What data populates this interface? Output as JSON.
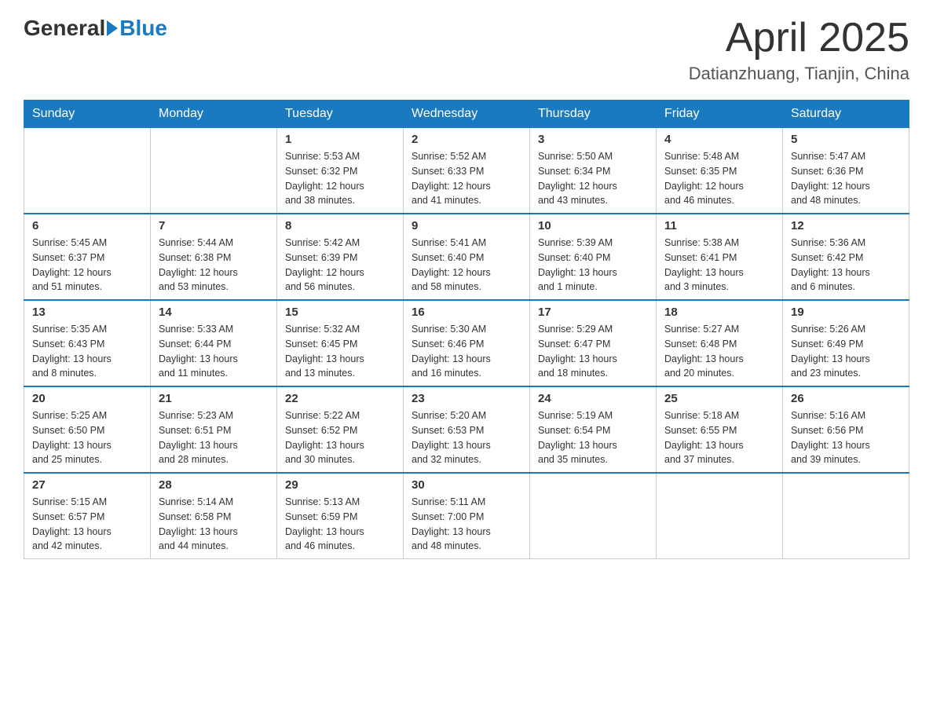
{
  "header": {
    "logo_general": "General",
    "logo_blue": "Blue",
    "month_title": "April 2025",
    "location": "Datianzhuang, Tianjin, China"
  },
  "days_of_week": [
    "Sunday",
    "Monday",
    "Tuesday",
    "Wednesday",
    "Thursday",
    "Friday",
    "Saturday"
  ],
  "weeks": [
    {
      "days": [
        {
          "date": "",
          "info": ""
        },
        {
          "date": "",
          "info": ""
        },
        {
          "date": "1",
          "info": "Sunrise: 5:53 AM\nSunset: 6:32 PM\nDaylight: 12 hours\nand 38 minutes."
        },
        {
          "date": "2",
          "info": "Sunrise: 5:52 AM\nSunset: 6:33 PM\nDaylight: 12 hours\nand 41 minutes."
        },
        {
          "date": "3",
          "info": "Sunrise: 5:50 AM\nSunset: 6:34 PM\nDaylight: 12 hours\nand 43 minutes."
        },
        {
          "date": "4",
          "info": "Sunrise: 5:48 AM\nSunset: 6:35 PM\nDaylight: 12 hours\nand 46 minutes."
        },
        {
          "date": "5",
          "info": "Sunrise: 5:47 AM\nSunset: 6:36 PM\nDaylight: 12 hours\nand 48 minutes."
        }
      ]
    },
    {
      "days": [
        {
          "date": "6",
          "info": "Sunrise: 5:45 AM\nSunset: 6:37 PM\nDaylight: 12 hours\nand 51 minutes."
        },
        {
          "date": "7",
          "info": "Sunrise: 5:44 AM\nSunset: 6:38 PM\nDaylight: 12 hours\nand 53 minutes."
        },
        {
          "date": "8",
          "info": "Sunrise: 5:42 AM\nSunset: 6:39 PM\nDaylight: 12 hours\nand 56 minutes."
        },
        {
          "date": "9",
          "info": "Sunrise: 5:41 AM\nSunset: 6:40 PM\nDaylight: 12 hours\nand 58 minutes."
        },
        {
          "date": "10",
          "info": "Sunrise: 5:39 AM\nSunset: 6:40 PM\nDaylight: 13 hours\nand 1 minute."
        },
        {
          "date": "11",
          "info": "Sunrise: 5:38 AM\nSunset: 6:41 PM\nDaylight: 13 hours\nand 3 minutes."
        },
        {
          "date": "12",
          "info": "Sunrise: 5:36 AM\nSunset: 6:42 PM\nDaylight: 13 hours\nand 6 minutes."
        }
      ]
    },
    {
      "days": [
        {
          "date": "13",
          "info": "Sunrise: 5:35 AM\nSunset: 6:43 PM\nDaylight: 13 hours\nand 8 minutes."
        },
        {
          "date": "14",
          "info": "Sunrise: 5:33 AM\nSunset: 6:44 PM\nDaylight: 13 hours\nand 11 minutes."
        },
        {
          "date": "15",
          "info": "Sunrise: 5:32 AM\nSunset: 6:45 PM\nDaylight: 13 hours\nand 13 minutes."
        },
        {
          "date": "16",
          "info": "Sunrise: 5:30 AM\nSunset: 6:46 PM\nDaylight: 13 hours\nand 16 minutes."
        },
        {
          "date": "17",
          "info": "Sunrise: 5:29 AM\nSunset: 6:47 PM\nDaylight: 13 hours\nand 18 minutes."
        },
        {
          "date": "18",
          "info": "Sunrise: 5:27 AM\nSunset: 6:48 PM\nDaylight: 13 hours\nand 20 minutes."
        },
        {
          "date": "19",
          "info": "Sunrise: 5:26 AM\nSunset: 6:49 PM\nDaylight: 13 hours\nand 23 minutes."
        }
      ]
    },
    {
      "days": [
        {
          "date": "20",
          "info": "Sunrise: 5:25 AM\nSunset: 6:50 PM\nDaylight: 13 hours\nand 25 minutes."
        },
        {
          "date": "21",
          "info": "Sunrise: 5:23 AM\nSunset: 6:51 PM\nDaylight: 13 hours\nand 28 minutes."
        },
        {
          "date": "22",
          "info": "Sunrise: 5:22 AM\nSunset: 6:52 PM\nDaylight: 13 hours\nand 30 minutes."
        },
        {
          "date": "23",
          "info": "Sunrise: 5:20 AM\nSunset: 6:53 PM\nDaylight: 13 hours\nand 32 minutes."
        },
        {
          "date": "24",
          "info": "Sunrise: 5:19 AM\nSunset: 6:54 PM\nDaylight: 13 hours\nand 35 minutes."
        },
        {
          "date": "25",
          "info": "Sunrise: 5:18 AM\nSunset: 6:55 PM\nDaylight: 13 hours\nand 37 minutes."
        },
        {
          "date": "26",
          "info": "Sunrise: 5:16 AM\nSunset: 6:56 PM\nDaylight: 13 hours\nand 39 minutes."
        }
      ]
    },
    {
      "days": [
        {
          "date": "27",
          "info": "Sunrise: 5:15 AM\nSunset: 6:57 PM\nDaylight: 13 hours\nand 42 minutes."
        },
        {
          "date": "28",
          "info": "Sunrise: 5:14 AM\nSunset: 6:58 PM\nDaylight: 13 hours\nand 44 minutes."
        },
        {
          "date": "29",
          "info": "Sunrise: 5:13 AM\nSunset: 6:59 PM\nDaylight: 13 hours\nand 46 minutes."
        },
        {
          "date": "30",
          "info": "Sunrise: 5:11 AM\nSunset: 7:00 PM\nDaylight: 13 hours\nand 48 minutes."
        },
        {
          "date": "",
          "info": ""
        },
        {
          "date": "",
          "info": ""
        },
        {
          "date": "",
          "info": ""
        }
      ]
    }
  ]
}
